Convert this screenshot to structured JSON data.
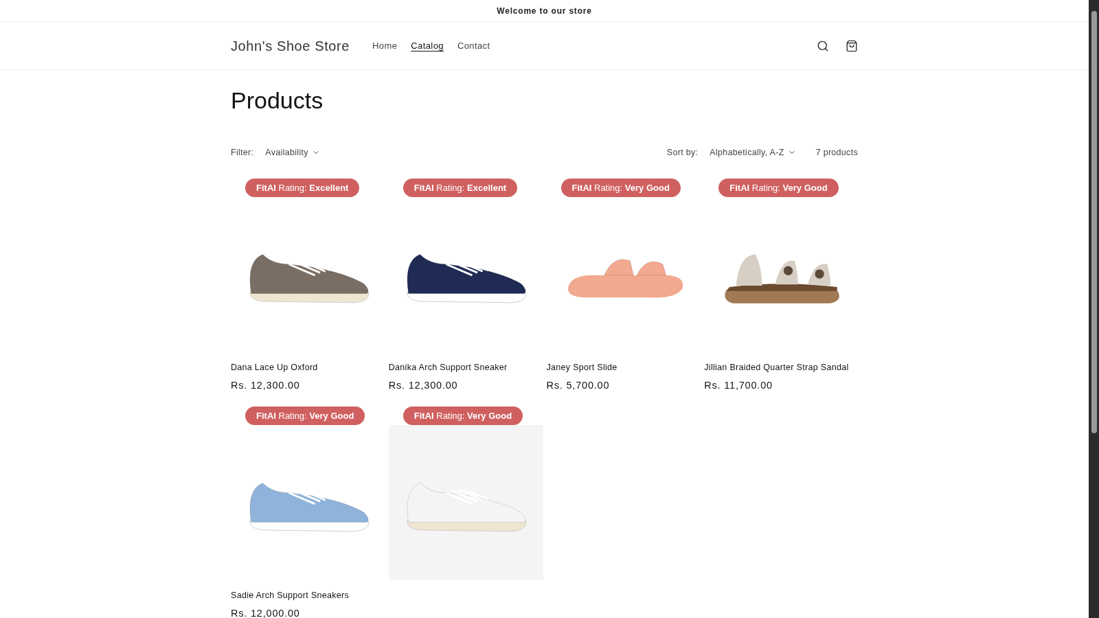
{
  "announcement": "Welcome to our store",
  "header": {
    "store_name": "John's Shoe Store",
    "nav": [
      {
        "label": "Home",
        "selected": false
      },
      {
        "label": "Catalog",
        "selected": true
      },
      {
        "label": "Contact",
        "selected": false
      }
    ]
  },
  "page_title": "Products",
  "toolbar": {
    "filter_label": "Filter:",
    "filter_value": "Availability",
    "sort_label": "Sort by:",
    "sort_value": "Alphabetically, A-Z",
    "count": "7 products"
  },
  "products": [
    {
      "badge": "**FitAI** Rating: **Excellent**",
      "kind": "shoe",
      "color": "#7a6e64",
      "name": "Dana Lace Up Oxford",
      "price": "Rs. 12,300.00"
    },
    {
      "badge": "**FitAI** Rating: **Excellent**",
      "kind": "sneaker",
      "color": "#1f2a55",
      "name": "Danika Arch Support Sneaker",
      "price": "Rs. 12,300.00"
    },
    {
      "badge": "**FitAI** Rating: **Very Good**",
      "kind": "slide",
      "color": "#f2a98f",
      "name": "Janey Sport Slide",
      "price": "Rs. 5,700.00"
    },
    {
      "badge": "**FitAI** Rating: **Very Good**",
      "kind": "sandal",
      "color": "#d8cfc4",
      "name": "Jillian Braided Quarter Strap Sandal",
      "price": "Rs. 11,700.00"
    },
    {
      "badge": "**FitAI** Rating: **Very Good**",
      "kind": "sneaker",
      "color": "#8fb3da",
      "name": "Sadie Arch Support Sneakers",
      "price": "Rs. 12,000.00"
    },
    {
      "badge": "**FitAI** Rating: **Very Good**",
      "kind": "studio-shoe",
      "color": "#f4f4f4"
    }
  ]
}
